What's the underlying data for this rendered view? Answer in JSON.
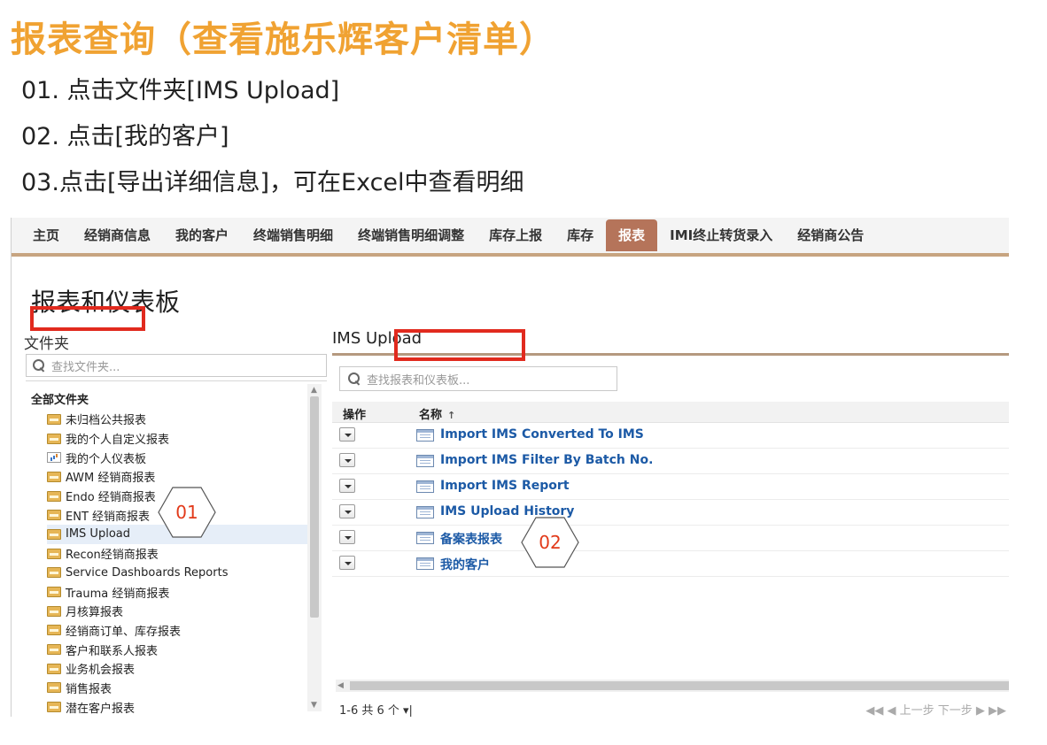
{
  "slide": {
    "title": "报表查询（查看施乐辉客户清单）",
    "steps": [
      "01. 点击文件夹[IMS Upload]",
      "02. 点击[我的客户]",
      "03.点击[导出详细信息]，可在Excel中查看明细"
    ]
  },
  "colors": {
    "title": "#f0a232",
    "active_tab": "#b5745a",
    "link": "#1c5aa6",
    "highlight": "#e12a1e"
  },
  "nav": {
    "tabs": [
      "主页",
      "经销商信息",
      "我的客户",
      "终端销售明细",
      "终端销售明细调整",
      "库存上报",
      "库存",
      "报表",
      "IMI终止转货录入",
      "经销商公告"
    ],
    "active": "报表"
  },
  "page": {
    "heading": "报表和仪表板"
  },
  "folders": {
    "label": "文件夹",
    "search_placeholder": "查找文件夹...",
    "all_label": "全部文件夹",
    "items": [
      {
        "label": "未归档公共报表",
        "icon": "folder-icon"
      },
      {
        "label": "我的个人自定义报表",
        "icon": "folder-icon"
      },
      {
        "label": "我的个人仪表板",
        "icon": "dashboard-icon"
      },
      {
        "label": "AWM 经销商报表",
        "icon": "folder-icon"
      },
      {
        "label": "Endo 经销商报表",
        "icon": "folder-icon"
      },
      {
        "label": "ENT 经销商报表",
        "icon": "folder-icon"
      },
      {
        "label": "IMS Upload",
        "icon": "folder-icon",
        "selected": true
      },
      {
        "label": "Recon经销商报表",
        "icon": "folder-icon"
      },
      {
        "label": "Service Dashboards Reports",
        "icon": "folder-icon"
      },
      {
        "label": "Trauma 经销商报表",
        "icon": "folder-icon"
      },
      {
        "label": "月核算报表",
        "icon": "folder-icon"
      },
      {
        "label": "经销商订单、库存报表",
        "icon": "folder-icon"
      },
      {
        "label": "客户和联系人报表",
        "icon": "folder-icon"
      },
      {
        "label": "业务机会报表",
        "icon": "folder-icon"
      },
      {
        "label": "销售报表",
        "icon": "folder-icon"
      },
      {
        "label": "潜在客户报表",
        "icon": "folder-icon"
      }
    ]
  },
  "reports": {
    "title": "IMS Upload",
    "search_placeholder": "查找报表和仪表板...",
    "columns": {
      "action": "操作",
      "name": "名称",
      "sort_indicator": "↑"
    },
    "rows": [
      {
        "name": "Import IMS Converted To IMS"
      },
      {
        "name": "Import IMS Filter By Batch No."
      },
      {
        "name": "Import IMS Report"
      },
      {
        "name": "IMS Upload History"
      },
      {
        "name": "备案表报表"
      },
      {
        "name": "我的客户"
      }
    ],
    "pager": {
      "count": "1-6 共 6 个 ▾|",
      "nav": "◀◀ ◀ 上一步 下一步 ▶ ▶▶"
    }
  },
  "callouts": {
    "c01": "01",
    "c02": "02"
  }
}
